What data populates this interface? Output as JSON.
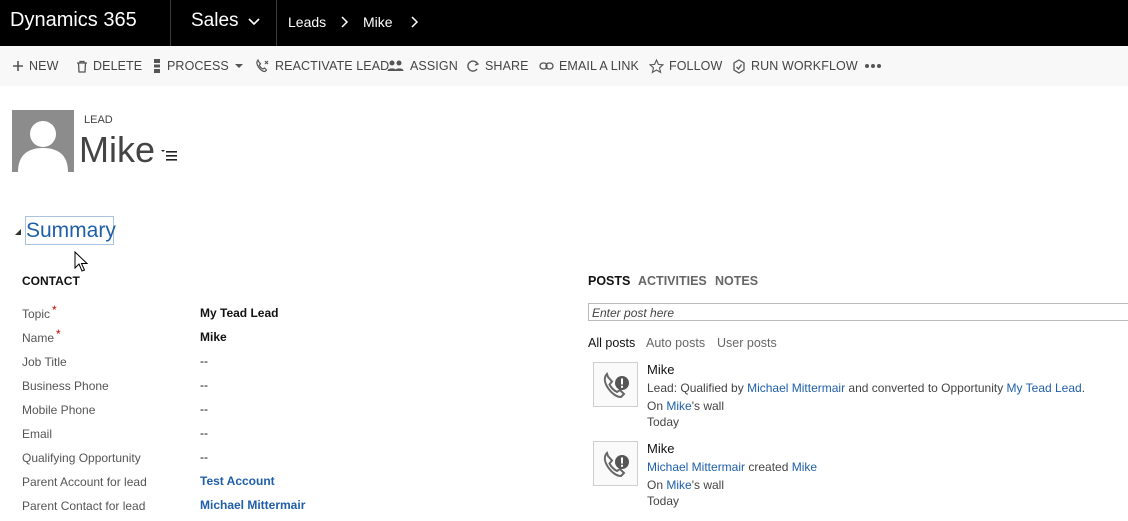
{
  "nav": {
    "brand": "Dynamics 365",
    "app": "Sales",
    "breadcrumbs": [
      "Leads",
      "Mike"
    ]
  },
  "commands": {
    "new": "NEW",
    "delete": "DELETE",
    "process": "PROCESS",
    "reactivate": "REACTIVATE LEAD",
    "assign": "ASSIGN",
    "share": "SHARE",
    "email_link": "EMAIL A LINK",
    "follow": "FOLLOW",
    "run_workflow": "RUN WORKFLOW"
  },
  "header": {
    "entity_type": "LEAD",
    "record_name": "Mike"
  },
  "summary": {
    "title": "Summary",
    "contact_heading": "CONTACT",
    "fields": [
      {
        "label": "Topic",
        "value": "My Tead Lead"
      },
      {
        "label": "Name",
        "value": "Mike"
      },
      {
        "label": "Job Title",
        "value": "--"
      },
      {
        "label": "Business Phone",
        "value": "--"
      },
      {
        "label": "Mobile Phone",
        "value": "--"
      },
      {
        "label": "Email",
        "value": "--"
      },
      {
        "label": "Qualifying Opportunity",
        "value": "--"
      },
      {
        "label": "Parent Account for lead",
        "value": "Test Account"
      },
      {
        "label": "Parent Contact for lead",
        "value": "Michael Mittermair"
      }
    ],
    "required_mark": "*"
  },
  "social": {
    "tabs": [
      "POSTS",
      "ACTIVITIES",
      "NOTES"
    ],
    "post_placeholder": "Enter post here",
    "filters": [
      "All posts",
      "Auto posts",
      "User posts"
    ],
    "posts": [
      {
        "author": "Mike",
        "text_prefix": "Lead: Qualified by ",
        "link1": "Michael Mittermair",
        "text_mid": " and converted to Opportunity ",
        "link2": "My Tead Lead",
        "text_end": ".",
        "wall_prefix": "On ",
        "wall_link": "Mike",
        "wall_suffix": "'s wall",
        "time": "Today"
      },
      {
        "author": "Mike",
        "link1": "Michael Mittermair",
        "text_mid": " created ",
        "link2": "Mike",
        "wall_prefix": "On ",
        "wall_link": "Mike",
        "wall_suffix": "'s wall",
        "time": "Today"
      }
    ]
  },
  "icons": [
    "plus-icon",
    "trash-icon",
    "process-icon",
    "phone-icon",
    "assign-icon",
    "share-icon",
    "link-icon",
    "star-icon",
    "workflow-icon",
    "ellipsis-icon",
    "chevron-down-icon",
    "chevron-right-icon",
    "person-icon",
    "menu-icon",
    "phone-alert-icon"
  ]
}
